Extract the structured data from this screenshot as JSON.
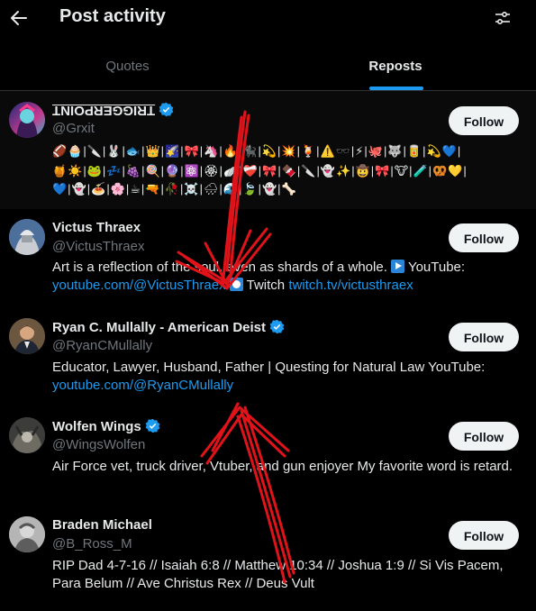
{
  "header": {
    "title": "Post activity",
    "back_icon": "arrow-left-icon",
    "settings_icon": "sliders-icon"
  },
  "tabs": [
    {
      "label": "Quotes",
      "active": false
    },
    {
      "label": "Reposts",
      "active": true
    }
  ],
  "accent": "#1d9bf0",
  "users": [
    {
      "name": "TRIGGERPOINT",
      "handle": "@Grxit",
      "verified": true,
      "follow_label": "Follow",
      "emoji_line1": "🏈🧁|🔪|🐰|🐟|👑|🌠|🎀|🦄|🔥|🐈‍⬛|💫|💥|🍹|⚠️🕶️|⚡|🐙|🐺|🥫|💫💙|",
      "emoji_line2": "🍯☀️|🐸|💤|🍇|🍭|🔮|⚛️|🏵|🪽|❤️‍🩹|🎀|🍫|🔪|👻✨|🤠|🎀|🐮|🧪|🥨💛|",
      "emoji_line3": "💙|👻|🍝|🌸|☕|🔫|🥀|☠️|🌧|🌊|🍃|👻|🦴"
    },
    {
      "name": "Victus Thraex",
      "handle": "@VictusThraex",
      "verified": false,
      "follow_label": "Follow",
      "bio_text": "Art is a reflection of the soul, even as shards of a whole.",
      "bio_youtube_prefix": "YouTube:",
      "bio_youtube_link": "youtube.com/@VictusThraex",
      "bio_twitch_prefix": "Twitch",
      "bio_twitch_link": "twitch.tv/victusthraex"
    },
    {
      "name": "Ryan C. Mullally - American Deist",
      "handle": "@RyanCMullally",
      "verified": true,
      "follow_label": "Follow",
      "bio_text": "Educator, Lawyer, Husband, Father | Questing for Natural Law YouTube:",
      "bio_link": "youtube.com/@RyanCMullally"
    },
    {
      "name": "Wolfen Wings",
      "handle": "@WingsWolfen",
      "verified": true,
      "follow_label": "Follow",
      "bio_text": "Air Force vet, truck driver, Vtuber, and gun enjoyer My favorite word is retard."
    },
    {
      "name": "Braden Michael",
      "handle": "@B_Ross_M",
      "verified": false,
      "follow_label": "Follow",
      "bio_text": "RIP Dad 4-7-16 // Isaiah 6:8 // Matthew 10:34 // Joshua 1:9 // Si Vis Pacem, Para Belum // Ave Christus Rex // Deus Vult"
    }
  ],
  "annotation_color": "#e0131a"
}
